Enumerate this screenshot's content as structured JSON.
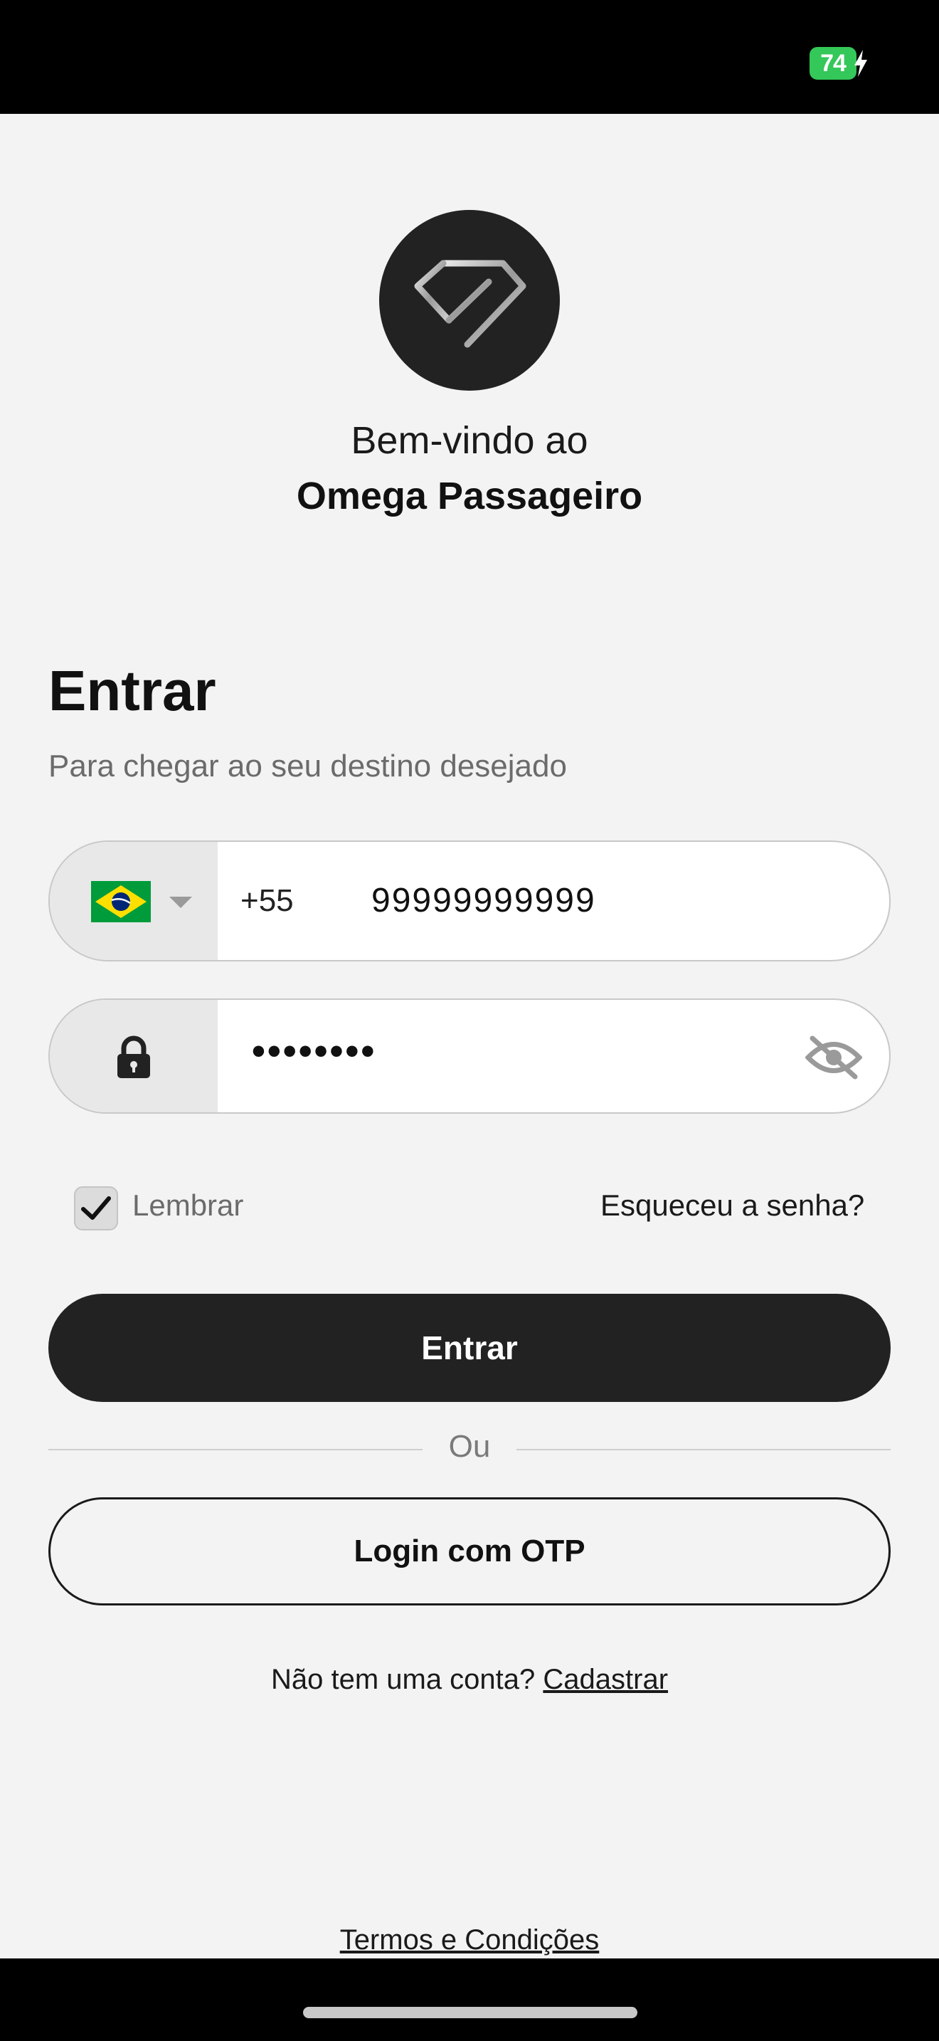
{
  "status_bar": {
    "battery": "74"
  },
  "welcome": {
    "line1": "Bem-vindo ao",
    "line2": "Omega Passageiro"
  },
  "login": {
    "title": "Entrar",
    "subtitle": "Para chegar ao seu destino desejado"
  },
  "phone_field": {
    "dial_code": "+55",
    "value": "99999999999"
  },
  "password_field": {
    "value": "••••••••"
  },
  "remember": {
    "label": "Lembrar",
    "checked": true
  },
  "forgot": {
    "label": "Esqueceu a senha?"
  },
  "buttons": {
    "primary": "Entrar",
    "divider": "Ou",
    "otp": "Login com OTP"
  },
  "signup": {
    "prompt": "Não tem uma conta?",
    "link": "Cadastrar"
  },
  "terms": {
    "label": "Termos e Condições"
  },
  "colors": {
    "accent": "#222222",
    "battery": "#34c759",
    "background": "#f3f3f3"
  },
  "icons": [
    "diamond-logo-icon",
    "brazil-flag-icon",
    "chevron-down-icon",
    "lock-icon",
    "eye-off-icon",
    "checkmark-icon",
    "bolt-icon"
  ]
}
